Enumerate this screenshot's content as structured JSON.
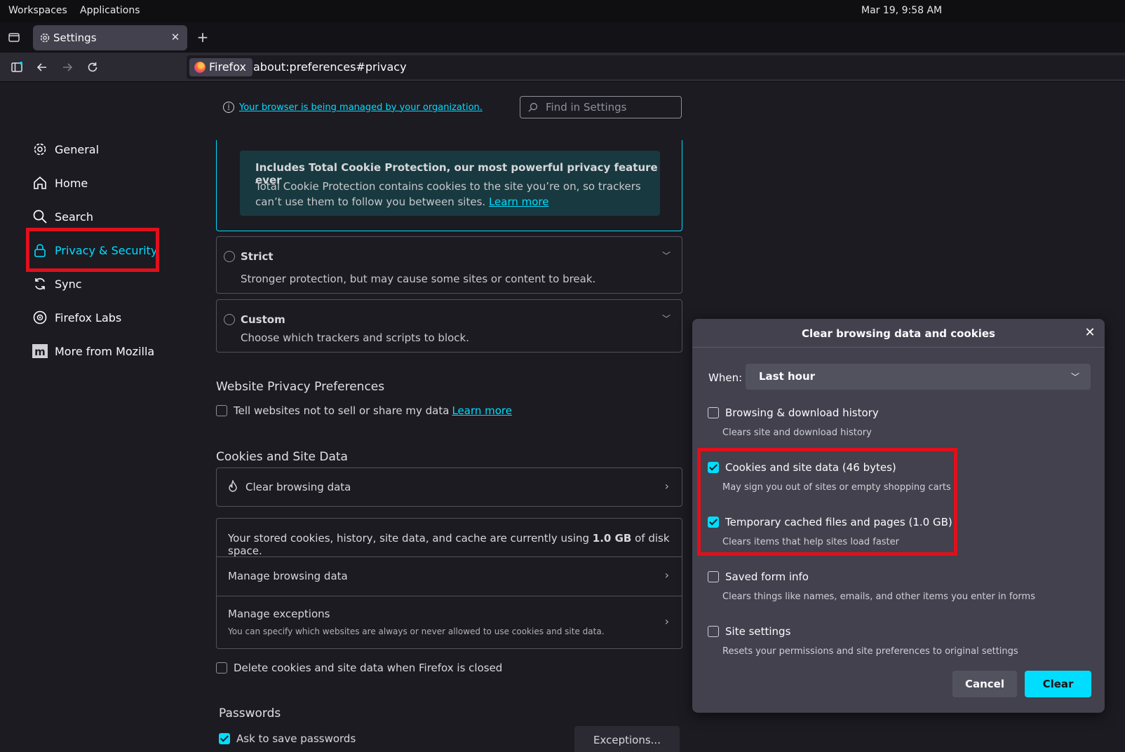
{
  "system_bar": {
    "menus": [
      "Workspaces",
      "Applications"
    ],
    "clock": "Mar 19, 9:58 AM"
  },
  "tab": {
    "title": "Settings",
    "icon": "gear-icon"
  },
  "navbar": {
    "identity_label": "Firefox",
    "url": "about:preferences#privacy"
  },
  "sidebar": {
    "items": [
      {
        "label": "General",
        "icon": "gear-icon"
      },
      {
        "label": "Home",
        "icon": "home-icon"
      },
      {
        "label": "Search",
        "icon": "search-icon"
      },
      {
        "label": "Privacy & Security",
        "icon": "lock-icon",
        "selected": true
      },
      {
        "label": "Sync",
        "icon": "sync-icon"
      },
      {
        "label": "Firefox Labs",
        "icon": "labs-icon"
      },
      {
        "label": "More from Mozilla",
        "icon": "mozilla-icon"
      }
    ]
  },
  "content": {
    "managed_notice": "Your browser is being managed by your organization.",
    "search_placeholder": "Find in Settings",
    "tcp_title": "Includes Total Cookie Protection, our most powerful privacy feature ever",
    "tcp_text": "Total Cookie Protection contains cookies to the site you’re on, so trackers can’t use them to follow you between sites.",
    "tcp_link": "Learn more",
    "strict_title": "Strict",
    "strict_desc": "Stronger protection, but may cause some sites or content to break.",
    "custom_title": "Custom",
    "custom_desc": "Choose which trackers and scripts to block.",
    "wpp_title": "Website Privacy Preferences",
    "wpp_checkbox": "Tell websites not to sell or share my data",
    "wpp_link": "Learn more",
    "cookies_title": "Cookies and Site Data",
    "clear_browsing_data": "Clear browsing data",
    "storage_text_pre": "Your stored cookies, history, site data, and cache are currently using",
    "storage_size": "1.0 GB",
    "storage_text_post": "of disk space.",
    "manage_browsing_data": "Manage browsing data",
    "manage_exceptions": "Manage exceptions",
    "manage_exceptions_sub": "You can specify which websites are always or never allowed to use cookies and site data.",
    "delete_on_close": "Delete cookies and site data when Firefox is closed",
    "passwords_title": "Passwords",
    "ask_save_passwords": "Ask to save passwords",
    "exceptions_button": "Exceptions..."
  },
  "dialog": {
    "title": "Clear browsing data and cookies",
    "when_label": "When:",
    "when_value": "Last hour",
    "options": [
      {
        "label": "Browsing & download history",
        "sub": "Clears site and download history",
        "checked": false
      },
      {
        "label": "Cookies and site data (46 bytes)",
        "sub": "May sign you out of sites or empty shopping carts",
        "checked": true
      },
      {
        "label": "Temporary cached files and pages (1.0 GB)",
        "sub": "Clears items that help sites load faster",
        "checked": true
      },
      {
        "label": "Saved form info",
        "sub": "Clears things like names, emails, and other items you enter in forms",
        "checked": false
      },
      {
        "label": "Site settings",
        "sub": "Resets your permissions and site preferences to original settings",
        "checked": false
      }
    ],
    "cancel_label": "Cancel",
    "clear_label": "Clear"
  },
  "colors": {
    "accent": "#00ddff",
    "highlight": "#e0101b"
  }
}
